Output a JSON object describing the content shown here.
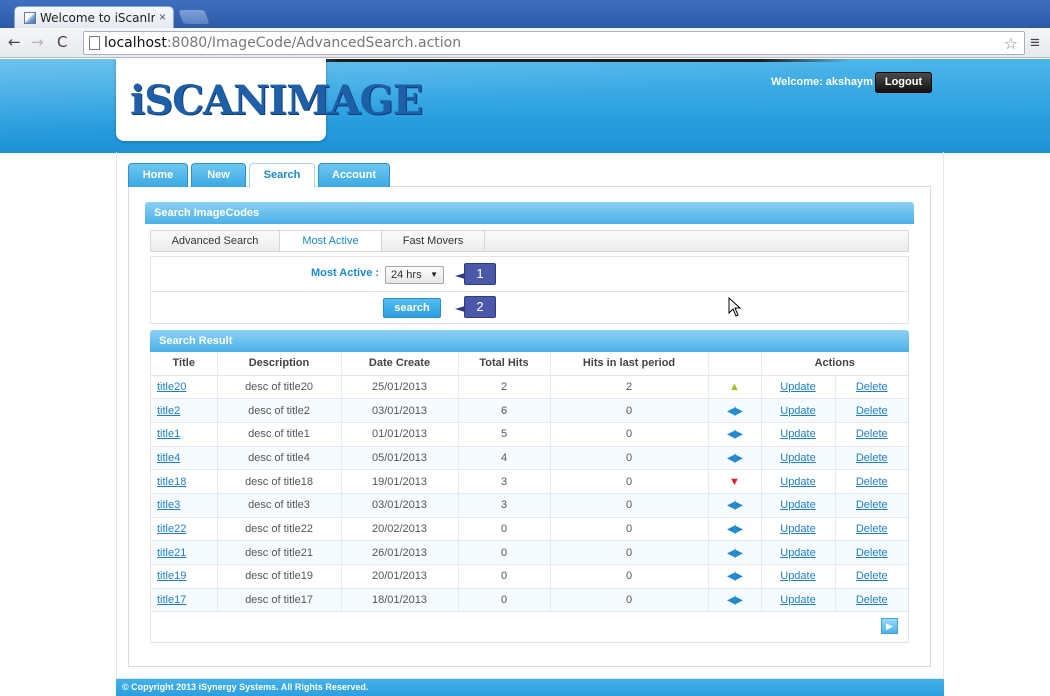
{
  "browser": {
    "tab_title": "Welcome to iScanImag",
    "tab_close": "×",
    "url_host": "localhost",
    "url_path": ":8080/ImageCode/AdvancedSearch.action",
    "back_icon": "←",
    "forward_icon": "→",
    "reload_icon": "C",
    "star_icon": "☆",
    "menu_icon": "≡"
  },
  "header": {
    "logo_text_i": "i",
    "logo_text_rest": "SCANIMAGE",
    "welcome_text": "Welcome: akshaym",
    "logout_label": "Logout"
  },
  "main_tabs": [
    {
      "label": "Home"
    },
    {
      "label": "New"
    },
    {
      "label": "Search"
    },
    {
      "label": "Account"
    }
  ],
  "search": {
    "heading": "Search ImageCodes",
    "tabs": [
      {
        "label": "Advanced Search"
      },
      {
        "label": "Most Active"
      },
      {
        "label": "Fast Movers"
      }
    ],
    "field_label": "Most Active :",
    "period_value": "24 hrs",
    "period_caret": "▼",
    "search_label": "search",
    "badge_1": "1",
    "badge_2": "2"
  },
  "results": {
    "heading": "Search Result",
    "columns": [
      "Title",
      "Description",
      "Date Create",
      "Total Hits",
      "Hits in last period",
      "",
      "Actions"
    ],
    "rows": [
      {
        "title": "title20",
        "description": "desc of title20",
        "date": "25/01/2013",
        "total_hits": "2",
        "hits_last": "2",
        "trend": "up",
        "trend_icon": "▲"
      },
      {
        "title": "title2",
        "description": "desc of title2",
        "date": "03/01/2013",
        "total_hits": "6",
        "hits_last": "0",
        "trend": "flat",
        "trend_icon": "◀|▶"
      },
      {
        "title": "title1",
        "description": "desc of title1",
        "date": "01/01/2013",
        "total_hits": "5",
        "hits_last": "0",
        "trend": "flat",
        "trend_icon": "◀|▶"
      },
      {
        "title": "title4",
        "description": "desc of title4",
        "date": "05/01/2013",
        "total_hits": "4",
        "hits_last": "0",
        "trend": "flat",
        "trend_icon": "◀|▶"
      },
      {
        "title": "title18",
        "description": "desc of title18",
        "date": "19/01/2013",
        "total_hits": "3",
        "hits_last": "0",
        "trend": "down",
        "trend_icon": "▼"
      },
      {
        "title": "title3",
        "description": "desc of title3",
        "date": "03/01/2013",
        "total_hits": "3",
        "hits_last": "0",
        "trend": "flat",
        "trend_icon": "◀|▶"
      },
      {
        "title": "title22",
        "description": "desc of title22",
        "date": "20/02/2013",
        "total_hits": "0",
        "hits_last": "0",
        "trend": "flat",
        "trend_icon": "◀|▶"
      },
      {
        "title": "title21",
        "description": "desc of title21",
        "date": "26/01/2013",
        "total_hits": "0",
        "hits_last": "0",
        "trend": "flat",
        "trend_icon": "◀|▶"
      },
      {
        "title": "title19",
        "description": "desc of title19",
        "date": "20/01/2013",
        "total_hits": "0",
        "hits_last": "0",
        "trend": "flat",
        "trend_icon": "◀|▶"
      },
      {
        "title": "title17",
        "description": "desc of title17",
        "date": "18/01/2013",
        "total_hits": "0",
        "hits_last": "0",
        "trend": "flat",
        "trend_icon": "◀|▶"
      }
    ],
    "update_label": "Update",
    "delete_label": "Delete",
    "next_icon": "▶"
  },
  "footer": {
    "copyright": "© Copyright 2013 iSynergy Systems. All Rights Reserved."
  },
  "colors": {
    "accent_blue": "#2ba0e0",
    "link_blue": "#1f7ec7",
    "badge_purple": "#4b57a8",
    "trend_up": "#9ac129",
    "trend_down": "#d9211d"
  }
}
